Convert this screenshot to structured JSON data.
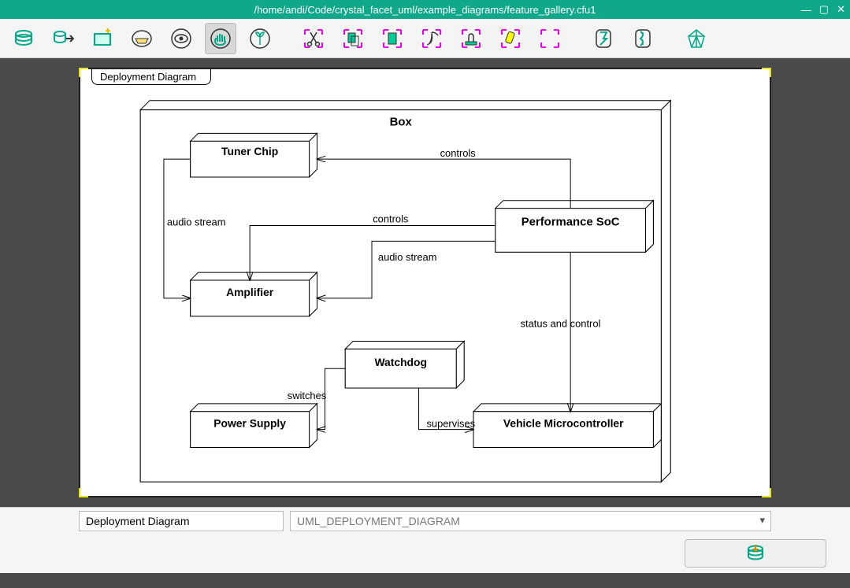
{
  "window": {
    "title": "/home/andi/Code/crystal_facet_uml/example_diagrams/feature_gallery.cfu1"
  },
  "diagram": {
    "tab_label": "Deployment Diagram",
    "container_title": "Box",
    "nodes": {
      "tuner": "Tuner Chip",
      "soc": "Performance SoC",
      "amp": "Amplifier",
      "watchdog": "Watchdog",
      "power": "Power Supply",
      "vehicle": "Vehicle Microcontroller"
    },
    "edges": {
      "controls1": "controls",
      "controls2": "controls",
      "audio1": "audio stream",
      "audio2": "audio stream",
      "status": "status and control",
      "switches": "switches",
      "supervises": "supervises"
    }
  },
  "bottom": {
    "name_value": "Deployment Diagram",
    "type_value": "UML_DEPLOYMENT_DIAGRAM"
  },
  "icons": {
    "db": "database-icon",
    "export": "export-icon",
    "newwin": "new-window-icon",
    "folder": "folder-icon",
    "eye": "eye-icon",
    "hand": "hand-icon",
    "plant": "plant-icon",
    "cut": "cut-icon",
    "copy": "copy-icon",
    "paste": "paste-icon",
    "reap": "delete-icon",
    "stamp": "stamp-icon",
    "highlight": "highlight-icon",
    "reset": "reset-icon",
    "undo": "undo-icon",
    "redo": "redo-icon",
    "crystal": "crystal-icon",
    "commit": "commit-icon"
  }
}
